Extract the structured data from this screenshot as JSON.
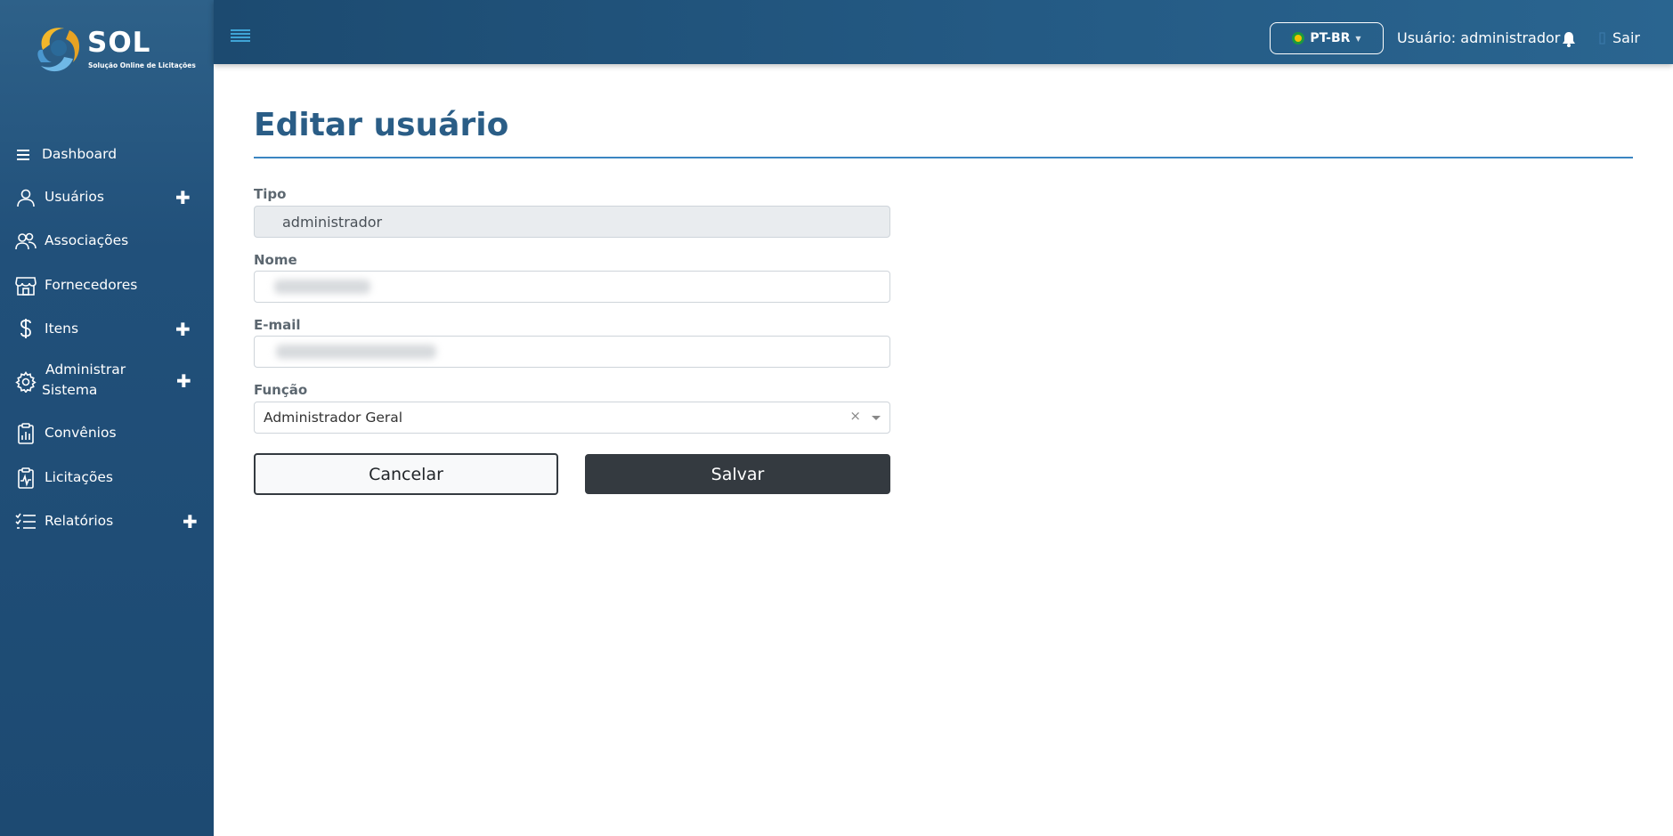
{
  "app": {
    "logo_text": "SOL",
    "logo_subtitle": "Solução Online de Licitações"
  },
  "sidebar": {
    "items": [
      {
        "label": "Dashboard",
        "icon": "menu-lines-icon",
        "expandable": false
      },
      {
        "label": "Usuários",
        "icon": "user-icon",
        "expandable": true
      },
      {
        "label": "Associações",
        "icon": "users-icon",
        "expandable": false
      },
      {
        "label": "Fornecedores",
        "icon": "store-icon",
        "expandable": false
      },
      {
        "label": "Itens",
        "icon": "dollar-icon",
        "expandable": true
      },
      {
        "label_line1": "Administrar",
        "label_line2": "Sistema",
        "icon": "gear-icon",
        "expandable": true
      },
      {
        "label": "Convênios",
        "icon": "clipboard-chart-icon",
        "expandable": false
      },
      {
        "label": "Licitações",
        "icon": "clipboard-pulse-icon",
        "expandable": false
      },
      {
        "label": "Relatórios",
        "icon": "checklist-icon",
        "expandable": true
      }
    ],
    "expand_symbol": "✚"
  },
  "header": {
    "language": "PT-BR",
    "user_label": "Usuário: administrador",
    "logout_label": "Sair"
  },
  "page": {
    "title": "Editar usuário"
  },
  "form": {
    "tipo": {
      "label": "Tipo",
      "value": "administrador"
    },
    "nome": {
      "label": "Nome"
    },
    "email": {
      "label": "E-mail"
    },
    "funcao": {
      "label": "Função",
      "value": "Administrador Geral",
      "clear_symbol": "×"
    },
    "cancel_label": "Cancelar",
    "save_label": "Salvar"
  },
  "colors": {
    "sidebar_bg": "#21507a",
    "topbar_bg": "#245a84",
    "title": "#2a5d86",
    "primary_dark_button": "#343a40",
    "divider": "#3b85c2"
  }
}
